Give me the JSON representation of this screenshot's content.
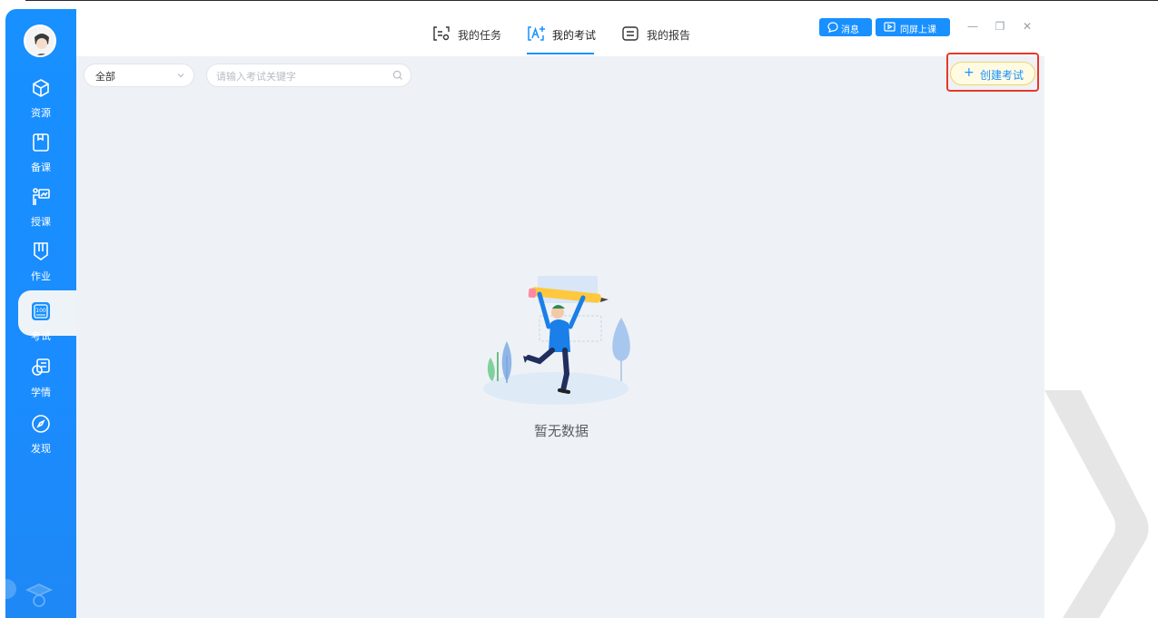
{
  "sidebar": {
    "items": [
      {
        "label": "资源",
        "icon": "cube-icon"
      },
      {
        "label": "备课",
        "icon": "book-icon"
      },
      {
        "label": "授课",
        "icon": "teach-icon"
      },
      {
        "label": "作业",
        "icon": "homework-icon"
      },
      {
        "label": "考试",
        "icon": "exam-icon",
        "active": true
      },
      {
        "label": "学情",
        "icon": "analytics-icon"
      },
      {
        "label": "发现",
        "icon": "compass-icon"
      }
    ]
  },
  "header": {
    "tabs": [
      {
        "label": "我的任务",
        "icon": "task-icon"
      },
      {
        "label": "我的考试",
        "icon": "exam-tab-icon",
        "active": true
      },
      {
        "label": "我的报告",
        "icon": "report-icon"
      }
    ],
    "message_label": "消息",
    "screen_share_label": "同屏上课",
    "minimize": "—",
    "maximize": "❐",
    "close": "✕"
  },
  "filters": {
    "select_value": "全部",
    "search_placeholder": "请输入考试关键字"
  },
  "create_button_label": "创建考试",
  "empty_state_text": "暂无数据",
  "colors": {
    "primary": "#1890ff",
    "background": "#eef2f6",
    "highlight_border": "#e8372b",
    "create_bg": "#fffbe3"
  }
}
